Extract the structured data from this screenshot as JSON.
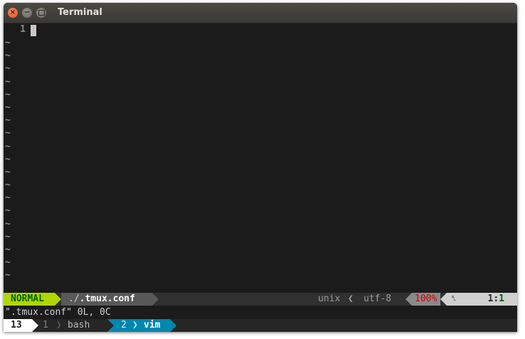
{
  "window": {
    "title": "Terminal"
  },
  "editor": {
    "line_number": "1",
    "empty_line_marker": "~",
    "empty_line_count": 19
  },
  "statusline": {
    "mode": "NORMAL",
    "file_path": "./",
    "file_name": ".tmux.conf",
    "fileformat": "unix",
    "separator": "❮",
    "encoding": "utf-8",
    "percent": "100%",
    "line_icon": "␤",
    "position_line": "1",
    "position_sep": ":",
    "position_col": "1"
  },
  "message": "\".tmux.conf\" 0L, 0C",
  "tmux": {
    "session": "13",
    "windows": [
      {
        "index": "1",
        "name": "bash",
        "active": false
      },
      {
        "index": "2",
        "name": "vim",
        "active": true
      }
    ],
    "separator": "❯"
  },
  "colors": {
    "mode_bg": "#afd700",
    "mode_fg": "#005f00",
    "active_window_bg": "#0087af",
    "percent_fg": "#d70000"
  }
}
